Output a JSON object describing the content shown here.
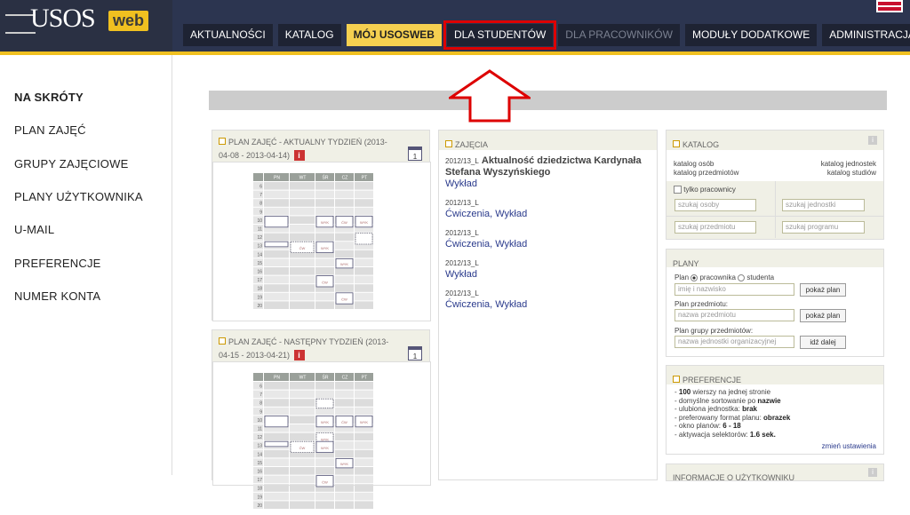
{
  "logo": {
    "main": "USOS",
    "web": "web"
  },
  "nav": {
    "tabs": [
      {
        "label": "AKTUALNOŚCI",
        "state": "normal"
      },
      {
        "label": "KATALOG",
        "state": "normal"
      },
      {
        "label": "MÓJ USOSWEB",
        "state": "active"
      },
      {
        "label": "DLA STUDENTÓW",
        "state": "highlighted"
      },
      {
        "label": "DLA PRACOWNIKÓW",
        "state": "disabled"
      },
      {
        "label": "MODUŁY DODATKOWE",
        "state": "normal"
      },
      {
        "label": "ADMINISTRACJA",
        "state": "normal"
      }
    ]
  },
  "sidebar": {
    "items": [
      "NA SKRÓTY",
      "PLAN ZAJĘĆ",
      "GRUPY ZAJĘCIOWE",
      "PLANY UŻYTKOWNIKA",
      "U-MAIL",
      "PREFERENCJE",
      "NUMER KONTA"
    ]
  },
  "plan1": {
    "title": "PLAN ZAJĘĆ - AKTUALNY TYDZIEŃ (2013-04-08 - 2013-04-14)"
  },
  "plan2": {
    "title": "PLAN ZAJĘĆ - NASTĘPNY TYDZIEŃ (2013-04-15 - 2013-04-21)"
  },
  "schedule": {
    "days": [
      "PN",
      "WT",
      "ŚR",
      "CZ",
      "PT"
    ],
    "hours": [
      "6",
      "7",
      "8",
      "9",
      "10",
      "11",
      "12",
      "13",
      "14",
      "15",
      "16",
      "17",
      "18",
      "19",
      "20"
    ],
    "labels": {
      "wyk": "WYK",
      "cw": "ĆW"
    }
  },
  "cal_icon": "1",
  "zajecia": {
    "title": "ZAJĘCIA",
    "items": [
      {
        "term": "2012/13_L",
        "name": "Aktualność dziedzictwa Kardynała Stefana Wyszyńskiego",
        "links": "Wykład"
      },
      {
        "term": "2012/13_L",
        "name": "",
        "links": "Ćwiczenia, Wykład"
      },
      {
        "term": "2012/13_L",
        "name": "",
        "links": "Ćwiczenia, Wykład"
      },
      {
        "term": "2012/13_L",
        "name": "",
        "links": "Wykład"
      },
      {
        "term": "2012/13_L",
        "name": "",
        "links": "Ćwiczenia, Wykład"
      }
    ]
  },
  "katalog": {
    "title": "KATALOG",
    "link_osob": "katalog osób",
    "link_przedmiotow": "katalog przedmiotów",
    "link_jednostek": "katalog jednostek",
    "link_studiow": "katalog studiów",
    "tylko_pracownicy": "tylko pracownicy",
    "ph_osoby": "szukaj osoby",
    "ph_jednostki": "szukaj jednostki",
    "ph_przedmiotu": "szukaj przedmiotu",
    "ph_programu": "szukaj programu"
  },
  "plany": {
    "title": "PLANY",
    "plan_label": "Plan",
    "opt_pracownika": "pracownika",
    "opt_studenta": "studenta",
    "ph_imie": "imię i nazwisko",
    "btn_pokaz1": "pokaż plan",
    "plan_przedmiotu": "Plan przedmiotu:",
    "ph_przedmiotu": "nazwa przedmiotu",
    "btn_pokaz2": "pokaż plan",
    "plan_grupy": "Plan grupy przedmiotów:",
    "ph_jednostki": "nazwa jednostki organizacyjnej",
    "btn_idz": "idź dalej"
  },
  "preferencje": {
    "title": "PREFERENCJE",
    "items": [
      {
        "pre": "- ",
        "b": "100",
        "post": " wierszy na jednej stronie"
      },
      {
        "pre": "- domyślne sortowanie po ",
        "b": "nazwie",
        "post": ""
      },
      {
        "pre": "- ulubiona jednostka: ",
        "b": "brak",
        "post": ""
      },
      {
        "pre": "- preferowany format planu: ",
        "b": "obrazek",
        "post": ""
      },
      {
        "pre": "- okno planów: ",
        "b": "6 - 18",
        "post": ""
      },
      {
        "pre": "- aktywacja selektorów: ",
        "b": "1.6 sek.",
        "post": ""
      }
    ],
    "link_zmien": "zmień ustawienia"
  },
  "info_uzytkowniku": {
    "title": "INFORMACJE O UŻYTKOWNIKU"
  },
  "colors": {
    "topbar": "#2c3550",
    "accent": "#f0c020",
    "highlight": "#dd0000",
    "link": "#2a3a8c"
  }
}
